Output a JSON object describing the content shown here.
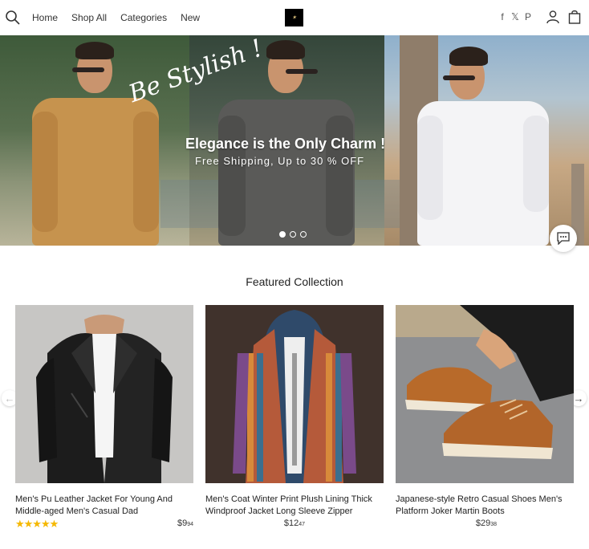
{
  "nav": {
    "items": [
      "Home",
      "Shop All",
      "Categories",
      "New"
    ],
    "social": [
      "f",
      "𝕏",
      "P"
    ]
  },
  "hero": {
    "script_text": "Be Stylish !",
    "headline": "Elegance is the Only Charm !",
    "subline": "Free Shipping, Up to 30 % OFF",
    "slide_count": 3,
    "active_slide": 1
  },
  "featured": {
    "title": "Featured Collection",
    "products": [
      {
        "name": "Men's Pu Leather Jacket For Young And Middle-aged Men's Casual Dad",
        "price_main": "$9",
        "price_cents": "94",
        "rating": 5
      },
      {
        "name": "Men's Coat Winter Print Plush Lining Thick Windproof Jacket Long Sleeve Zipper",
        "price_main": "$12",
        "price_cents": "47"
      },
      {
        "name": "Japanese-style Retro Casual Shoes Men's Platform Joker Martin Boots",
        "price_main": "$29",
        "price_cents": "38"
      }
    ]
  },
  "colors": {
    "accent_star": "#f5b800",
    "logo_bg": "#000000"
  }
}
